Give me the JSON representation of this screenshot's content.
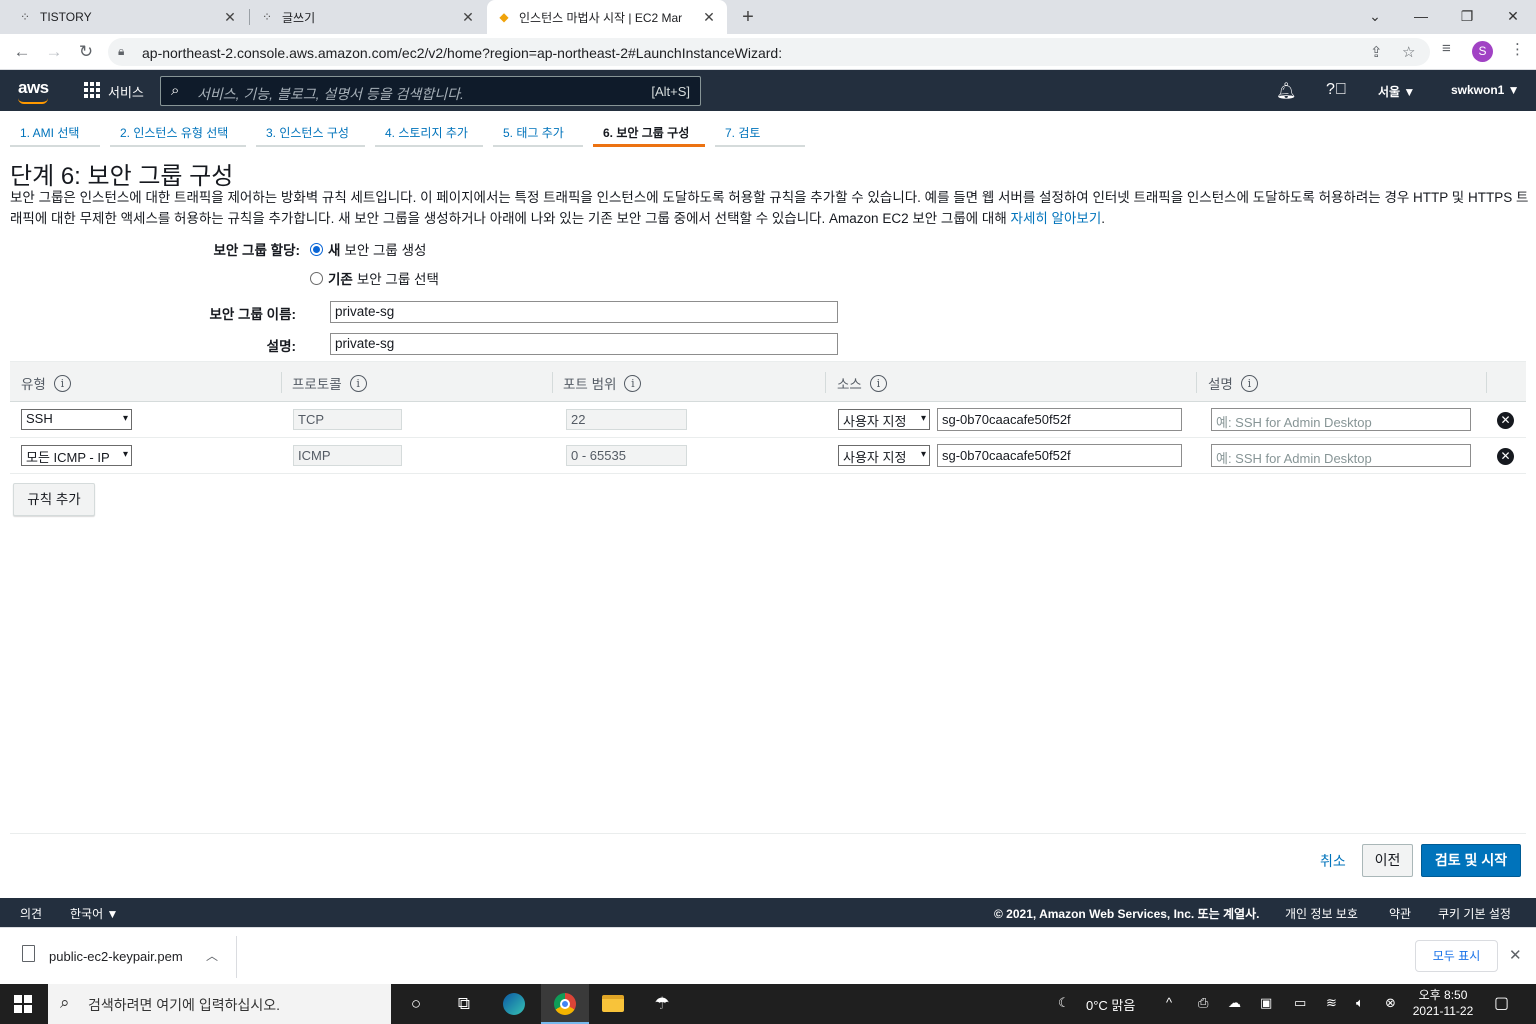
{
  "browser": {
    "tabs": [
      {
        "title": "TISTORY",
        "icon": "tistory-icon",
        "close": "✕"
      },
      {
        "title": "글쓰기",
        "icon": "tistory-icon",
        "close": "✕"
      },
      {
        "title": "인스턴스 마법사 시작 | EC2 Mar",
        "icon": "aws-box-icon",
        "close": "✕",
        "active": true
      }
    ],
    "new_tab": "+",
    "url": "ap-northeast-2.console.aws.amazon.com/ec2/v2/home?region=ap-northeast-2#LaunchInstanceWizard:",
    "profile_initial": "S"
  },
  "aws_header": {
    "logo": "aws",
    "services_label": "서비스",
    "search_placeholder": "서비스, 기능, 블로그, 설명서 등을 검색합니다.",
    "search_shortcut": "[Alt+S]",
    "region": "서울 ▼",
    "user": "swkwon1 ▼"
  },
  "wizard_tabs": [
    {
      "label": "1. AMI 선택"
    },
    {
      "label": "2. 인스턴스 유형 선택"
    },
    {
      "label": "3. 인스턴스 구성"
    },
    {
      "label": "4. 스토리지 추가"
    },
    {
      "label": "5. 태그 추가"
    },
    {
      "label": "6. 보안 그룹 구성",
      "active": true
    },
    {
      "label": "7. 검토"
    }
  ],
  "page": {
    "title": "단계 6: 보안 그룹 구성",
    "description": "보안 그룹은 인스턴스에 대한 트래픽을 제어하는 방화벽 규칙 세트입니다. 이 페이지에서는 특정 트래픽을 인스턴스에 도달하도록 허용할 규칙을 추가할 수 있습니다. 예를 들면 웹 서버를 설정하여 인터넷 트래픽을 인스턴스에 도달하도록 허용하려는 경우 HTTP 및 HTTPS 트래픽에 대한 무제한 액세스를 허용하는 규칙을 추가합니다. 새 보안 그룹을 생성하거나 아래에 나와 있는 기존 보안 그룹 중에서 선택할 수 있습니다. Amazon EC2 보안 그룹에 대해",
    "learn_more": "자세히 알아보기",
    "desc_end": "."
  },
  "form": {
    "assign_label": "보안 그룹 할당:",
    "option_new_bold": "새",
    "option_new_rest": "보안 그룹 생성",
    "option_existing_bold": "기존",
    "option_existing_rest": "보안 그룹 선택",
    "name_label": "보안 그룹 이름:",
    "name_value": "private-sg",
    "desc_label": "설명:",
    "desc_value": "private-sg"
  },
  "rules_table": {
    "headers": [
      "유형",
      "프로토콜",
      "포트 범위",
      "소스",
      "설명"
    ],
    "info": "i",
    "rows": [
      {
        "type": "SSH",
        "protocol": "TCP",
        "port": "22",
        "source_type": "사용자 지정",
        "source": "sg-0b70caacafe50f52f",
        "desc_placeholder": "예: SSH for Admin Desktop"
      },
      {
        "type": "모든 ICMP - IP",
        "protocol": "ICMP",
        "port": "0 - 65535",
        "source_type": "사용자 지정",
        "source": "sg-0b70caacafe50f52f",
        "desc_placeholder": "예: SSH for Admin Desktop"
      }
    ],
    "caret": "▾",
    "remove": "✕",
    "add_rule": "규칙 추가"
  },
  "actions": {
    "cancel": "취소",
    "previous": "이전",
    "review_launch": "검토 및 시작"
  },
  "aws_footer": {
    "feedback": "의견",
    "language": "한국어 ▼",
    "copyright": "© 2021, Amazon Web Services, Inc. 또는 계열사.",
    "privacy": "개인 정보 보호",
    "terms": "약관",
    "cookies": "쿠키 기본 설정"
  },
  "downloads": {
    "file": "public-ec2-keypair.pem",
    "show_all": "모두 표시"
  },
  "taskbar": {
    "search": "검색하려면 여기에 입력하십시오.",
    "weather": "0°C  맑음",
    "time": "오후 8:50",
    "date": "2021-11-22"
  },
  "colors": {
    "aws_header": "#232f3e",
    "aws_orange": "#ff9900",
    "link_blue": "#0073bb",
    "active_tab_orange": "#ec7211"
  }
}
